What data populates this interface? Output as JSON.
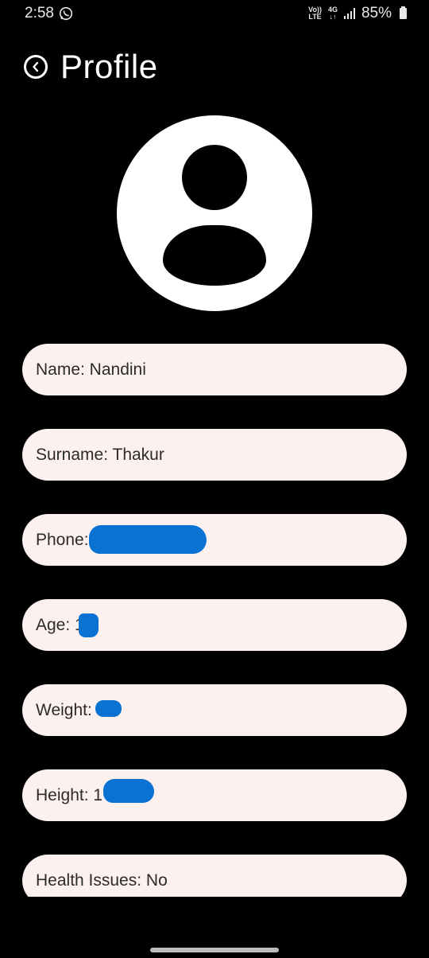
{
  "status_bar": {
    "time": "2:58",
    "network_top": "Vo))",
    "network_bottom": "LTE",
    "data_top": "4G",
    "data_bottom": "↓↑",
    "battery": "85%"
  },
  "header": {
    "title": "Profile"
  },
  "fields": [
    {
      "label": "Name: Nandini"
    },
    {
      "label": "Surname: Thakur"
    },
    {
      "label": "Phone:"
    },
    {
      "label": "Age: 1"
    },
    {
      "label": "Weight:"
    },
    {
      "label": "Height: 1"
    },
    {
      "label": "Health Issues: No"
    }
  ],
  "colors": {
    "background": "#000000",
    "field_background": "#fdf1ef",
    "redaction": "#0a72d2"
  }
}
